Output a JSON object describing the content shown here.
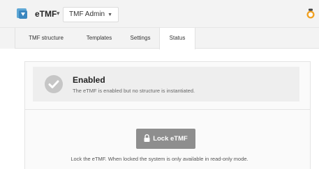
{
  "header": {
    "app_name": "eTMF",
    "app_caret": "▾",
    "role_label": "TMF Admin",
    "role_caret": "▼"
  },
  "tabs": [
    {
      "label": "TMF structure",
      "active": false
    },
    {
      "label": "Templates",
      "active": false
    },
    {
      "label": "Settings",
      "active": false
    },
    {
      "label": "Status",
      "active": true
    }
  ],
  "status": {
    "title": "Enabled",
    "description": "The eTMF is enabled but no structure is instantiated."
  },
  "lock": {
    "button_label": "Lock eTMF",
    "help_text": "Lock the eTMF. When locked the system is only available in read-only mode."
  },
  "colors": {
    "topbar_bg": "#f3f3f3",
    "button_bg": "#8e8e8e",
    "status_box_bg": "#eeeeee"
  }
}
